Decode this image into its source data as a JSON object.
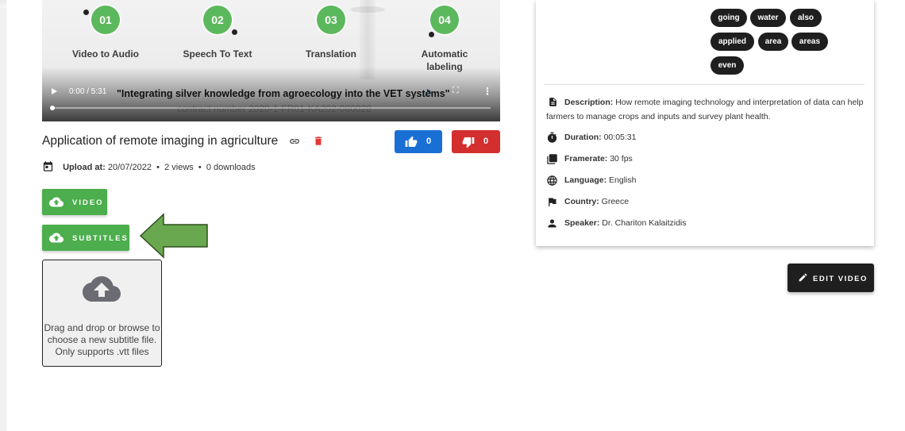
{
  "video": {
    "steps": [
      {
        "num": "01",
        "label": "Video to Audio"
      },
      {
        "num": "02",
        "label": "Speech To Text"
      },
      {
        "num": "03",
        "label": "Translation"
      },
      {
        "num": "04",
        "label": "Automatic labeling"
      }
    ],
    "overlay_title": "\"Integrating silver knowledge from agroecology into the VET systems\"",
    "contract": "contract number 2020-1-FR01-KA202-080028",
    "time": "0:00 / 5:31",
    "progress": 0.0
  },
  "title": "Application of remote imaging in agriculture",
  "likes": "0",
  "dislikes": "0",
  "upload": {
    "label": "Upload at:",
    "date": "20/07/2022",
    "views": "2 views",
    "downloads": "0 downloads",
    "sep": "•"
  },
  "buttons": {
    "video": "VIDEO",
    "subtitles": "SUBTITLES",
    "edit": "EDIT VIDEO"
  },
  "dropzone": {
    "line1": "Drag and drop or browse to",
    "line2": "choose a new subtitle file.",
    "line3": "Only supports .vtt files"
  },
  "tags": [
    "going",
    "water",
    "also",
    "applied",
    "area",
    "areas",
    "even"
  ],
  "details": {
    "description_label": "Description:",
    "description": "How remote imaging technology and interpretation of data can help farmers to manage crops and inputs and survey plant health.",
    "duration_label": "Duration:",
    "duration": "00:05:31",
    "framerate_label": "Framerate:",
    "framerate": "30 fps",
    "language_label": "Language:",
    "language": "English",
    "country_label": "Country:",
    "country": "Greece",
    "speaker_label": "Speaker:",
    "speaker": "Dr. Chariton Kalaitzidis"
  },
  "colors": {
    "green": "#4cae4c",
    "like_blue": "#1a6fd4",
    "dislike_red": "#d32f2f",
    "dark": "#1f1f1f",
    "arrow_green": "#6aa84f"
  }
}
